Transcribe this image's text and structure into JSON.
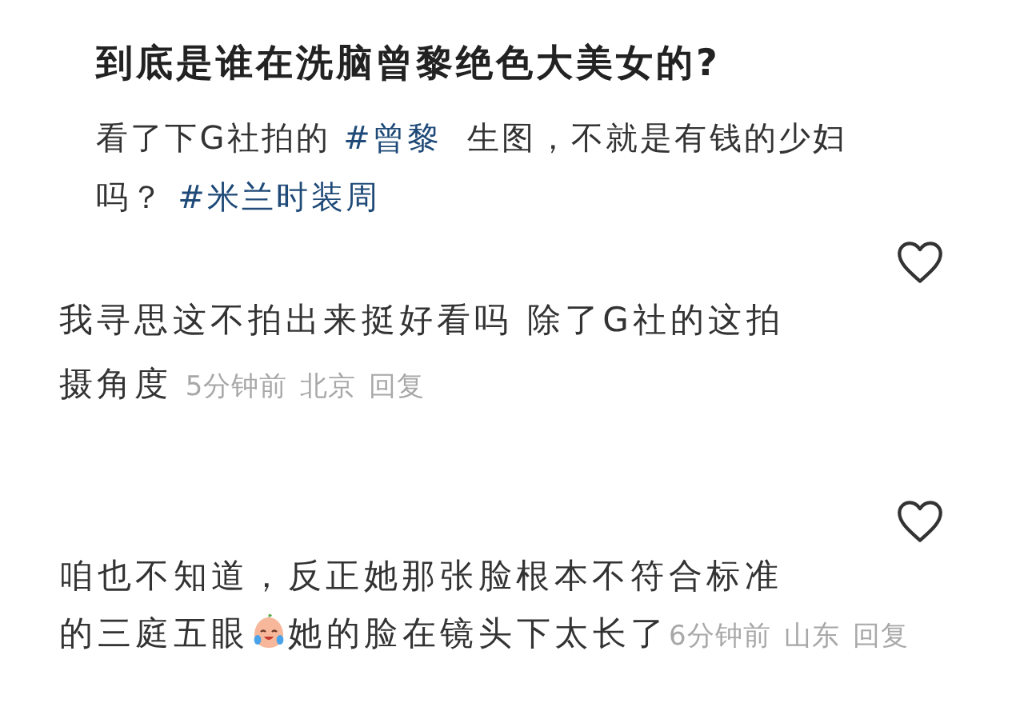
{
  "post": {
    "title": "到底是谁在洗脑曾黎绝色大美女的?",
    "lines": [
      [
        {
          "kind": "text",
          "text": "看了下G社拍的 "
        },
        {
          "kind": "hashtag",
          "text": "#曾黎"
        },
        {
          "kind": "text",
          "text": "  生图，不就是有钱的少妇"
        }
      ],
      [
        {
          "kind": "text",
          "text": "吗？ "
        },
        {
          "kind": "hashtag",
          "text": "#米兰时装周"
        }
      ]
    ]
  },
  "comments": [
    {
      "lines": [
        [
          {
            "kind": "text",
            "text": "我寻思这不拍出来挺好看吗 除了G社的这拍"
          }
        ],
        [
          {
            "kind": "text",
            "text": "摄角度"
          }
        ]
      ],
      "time": "5分钟前",
      "location": "北京",
      "reply": "回复"
    },
    {
      "lines": [
        [
          {
            "kind": "text",
            "text": "咱也不知道，反正她那张脸根本不符合标准"
          }
        ],
        [
          {
            "kind": "text",
            "text": "的三庭五眼"
          },
          {
            "kind": "emoji"
          },
          {
            "kind": "text",
            "text": "她的脸在镜头下太长了"
          }
        ]
      ],
      "time": "6分钟前",
      "location": "山东",
      "reply": "回复"
    }
  ]
}
